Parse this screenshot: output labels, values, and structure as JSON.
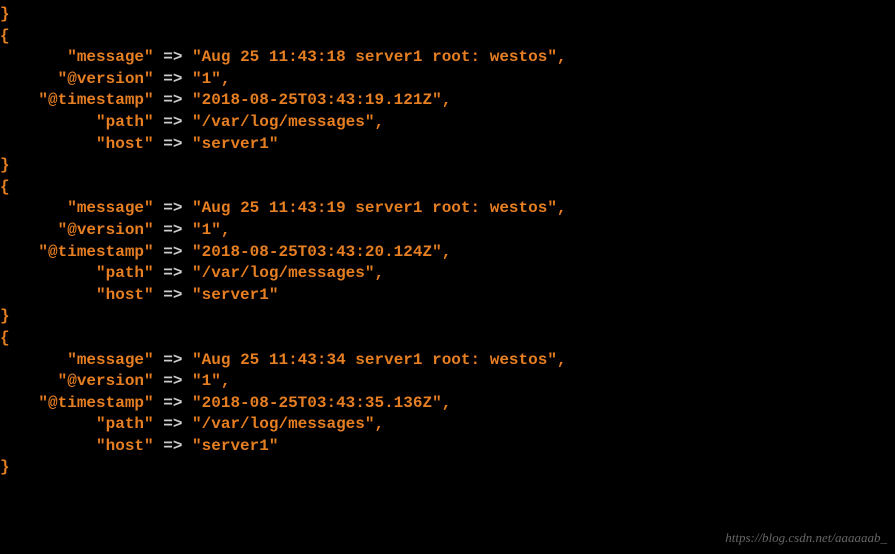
{
  "entries": [
    {
      "message": "\"Aug 25 11:43:18 server1 root: westos\"",
      "version": "\"1\"",
      "timestamp": "\"2018-08-25T03:43:19.121Z\"",
      "path": "\"/var/log/messages\"",
      "host": "\"server1\""
    },
    {
      "message": "\"Aug 25 11:43:19 server1 root: westos\"",
      "version": "\"1\"",
      "timestamp": "\"2018-08-25T03:43:20.124Z\"",
      "path": "\"/var/log/messages\"",
      "host": "\"server1\""
    },
    {
      "message": "\"Aug 25 11:43:34 server1 root: westos\"",
      "version": "\"1\"",
      "timestamp": "\"2018-08-25T03:43:35.136Z\"",
      "path": "\"/var/log/messages\"",
      "host": "\"server1\""
    }
  ],
  "labels": {
    "message_key": "\"message\"",
    "version_key": "\"@version\"",
    "timestamp_key": "\"@timestamp\"",
    "path_key": "\"path\"",
    "host_key": "\"host\"",
    "arrow": "=>",
    "open_brace": "{",
    "close_brace": "}",
    "comma": ","
  },
  "watermark": "https://blog.csdn.net/aaaaaab_"
}
